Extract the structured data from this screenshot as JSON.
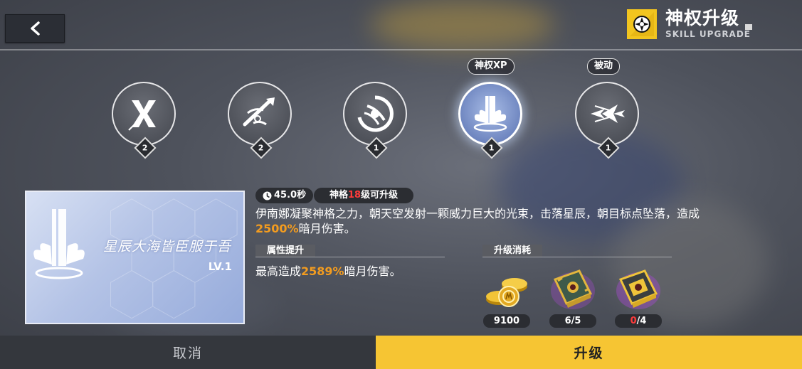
{
  "header": {
    "title_cn": "神权升级",
    "title_en": "SKILL UPGRADE"
  },
  "skills": [
    {
      "icon": "x-slash-icon",
      "level": "2",
      "tag": ""
    },
    {
      "icon": "spear-strike-icon",
      "level": "2",
      "tag": ""
    },
    {
      "icon": "swirl-claw-icon",
      "level": "1",
      "tag": ""
    },
    {
      "icon": "light-pillar-icon",
      "level": "1",
      "tag": "神权XP",
      "selected": true
    },
    {
      "icon": "burst-arrow-icon",
      "level": "1",
      "tag": "被动"
    }
  ],
  "preview": {
    "quote": "星辰大海皆臣服于吾",
    "level": "LV.1"
  },
  "info": {
    "cooldown": "45.0秒",
    "unlock_prefix": "神格",
    "unlock_level": "18",
    "unlock_suffix": "级可升级",
    "desc_part1": "伊南娜凝聚神格之力，朝天空发射一颗威力巨大的光束，击落星辰，朝目标点坠落，造成",
    "desc_value": "2500%",
    "desc_part2": "暗月伤害。"
  },
  "attribute": {
    "heading": "属性提升",
    "text_prefix": "最高造成",
    "text_value": "2589%",
    "text_suffix": "暗月伤害。"
  },
  "cost": {
    "heading": "升级消耗",
    "items": [
      {
        "icon": "gold-coins-icon",
        "count": "9100"
      },
      {
        "icon": "green-tome-icon",
        "have": "6",
        "need": "5"
      },
      {
        "icon": "gold-tome-icon",
        "have": "0",
        "need": "4"
      }
    ]
  },
  "buttons": {
    "cancel": "取消",
    "upgrade": "升级"
  },
  "colors": {
    "accent": "#f6c533",
    "highlight_orange": "#f39c1f",
    "insufficient_red": "#ff3b3b"
  }
}
